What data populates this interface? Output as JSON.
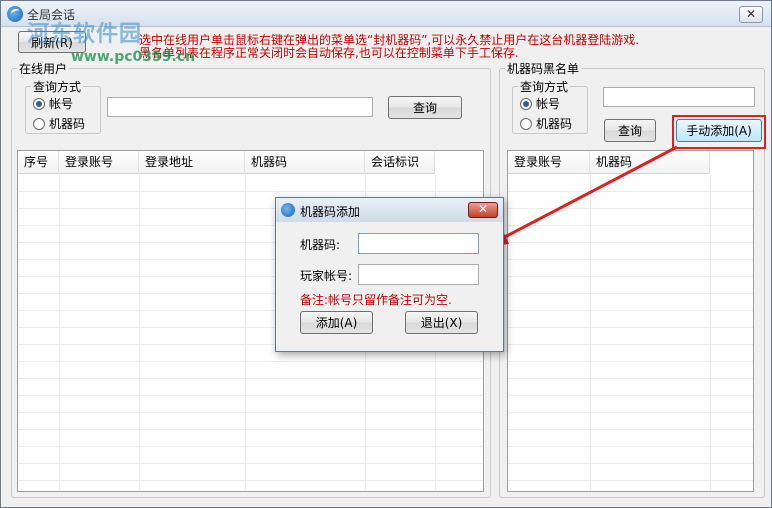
{
  "window": {
    "title": "全局会话",
    "close_label": "✕"
  },
  "watermark": {
    "text": "河东软件园",
    "url": "www.pc0359.cn"
  },
  "toolbar": {
    "refresh_label": "刷新(R)"
  },
  "hint": {
    "line1": "选中在线用户单击鼠标右键在弹出的菜单选“封机器码”,可以永久禁止用户在这台机器登陆游戏.",
    "line2": "黑名单列表在程序正常关闭时会自动保存,也可以在控制菜单下手工保存."
  },
  "online": {
    "group_title": "在线用户",
    "query_title": "查询方式",
    "radio_account": "帐号",
    "radio_machine": "机器码",
    "search_value": "",
    "query_button": "查询",
    "columns": [
      "序号",
      "登录账号",
      "登录地址",
      "机器码",
      "会话标识"
    ]
  },
  "blacklist": {
    "group_title": "机器码黑名单",
    "query_title": "查询方式",
    "radio_account": "帐号",
    "radio_machine": "机器码",
    "search_value": "",
    "query_button": "查询",
    "manual_add_button": "手动添加(A)",
    "columns": [
      "登录账号",
      "机器码"
    ]
  },
  "dialog": {
    "title": "机器码添加",
    "close_label": "✕",
    "machine_label": "机器码:",
    "machine_value": "",
    "player_label": "玩家帐号:",
    "player_value": "",
    "note": "备注:帐号只留作备注可为空.",
    "add_button": "添加(A)",
    "exit_button": "退出(X)"
  },
  "colors": {
    "hint": "#cc0000",
    "highlight": "#e02020"
  }
}
